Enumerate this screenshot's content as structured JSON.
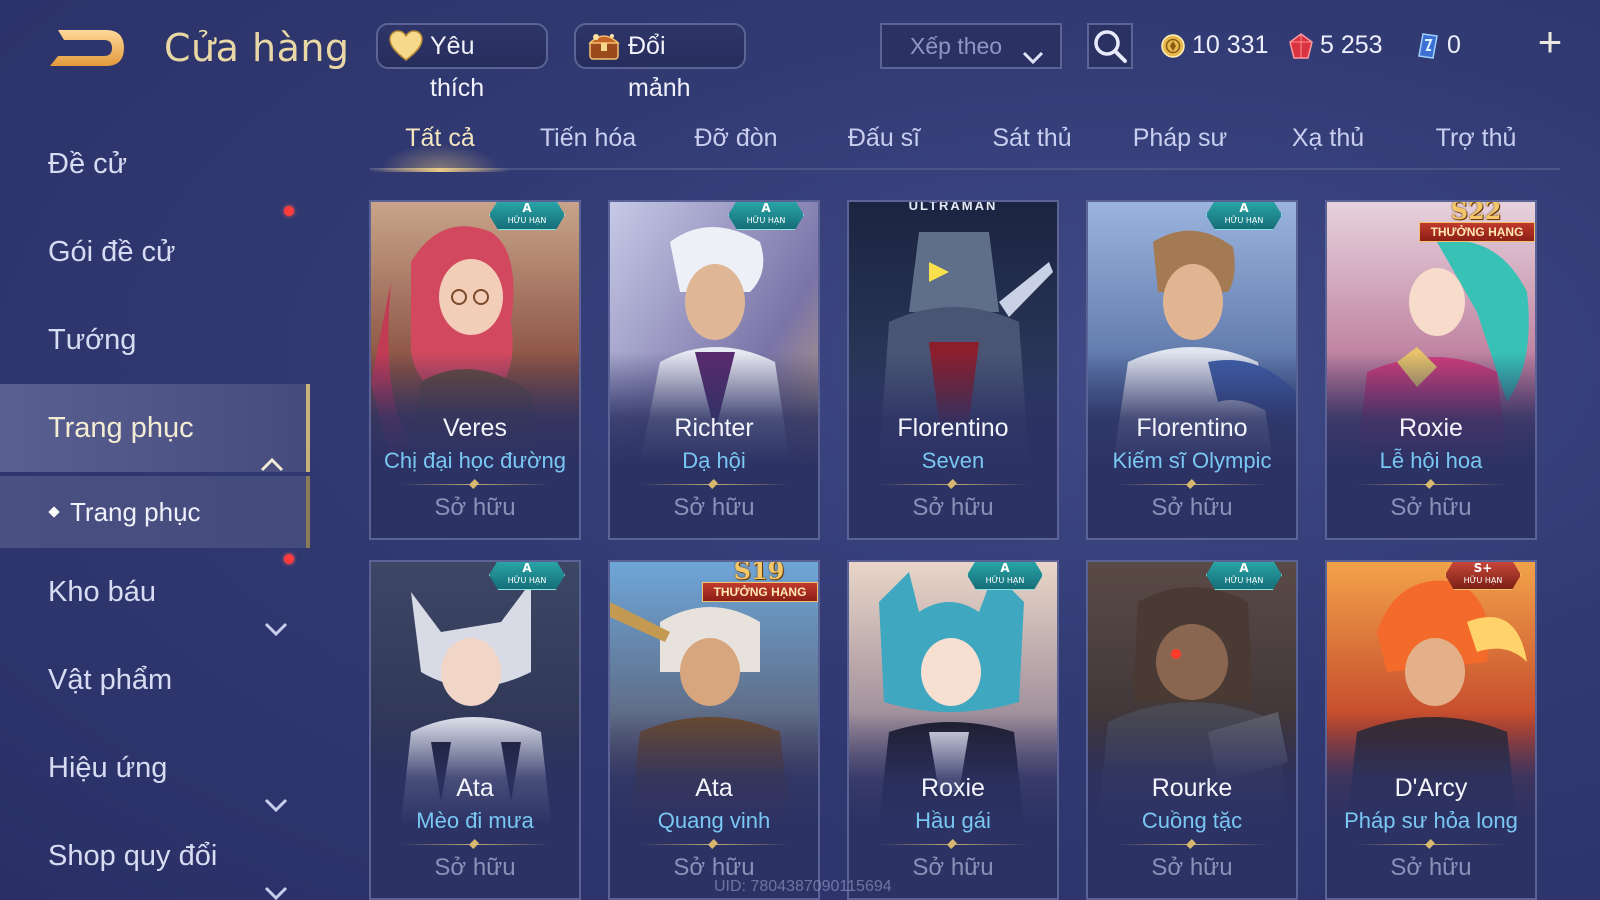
{
  "header": {
    "title": "Cửa hàng",
    "favorite_label": "Yêu thích",
    "shard_label": "Đổi mảnh",
    "sort_label": "Xếp theo",
    "currencies": [
      {
        "icon": "gold-coin-icon",
        "value": "10 331"
      },
      {
        "icon": "ruby-icon",
        "value": "5 253"
      },
      {
        "icon": "crystal-icon",
        "value": "0"
      }
    ],
    "plus_label": "+"
  },
  "sidebar": {
    "items": [
      {
        "label": "Đề cử"
      },
      {
        "label": "Gói đề cử"
      },
      {
        "label": "Tướng"
      },
      {
        "label": "Trang phục"
      },
      {
        "label": "Kho báu"
      },
      {
        "label": "Vật phẩm"
      },
      {
        "label": "Hiệu ứng"
      },
      {
        "label": "Shop quy đổi"
      }
    ],
    "sub_item": {
      "label": "Trang phục"
    }
  },
  "tabs": [
    {
      "label": "Tất cả"
    },
    {
      "label": "Tiến hóa"
    },
    {
      "label": "Đỡ đòn"
    },
    {
      "label": "Đấu sĩ"
    },
    {
      "label": "Sát thủ"
    },
    {
      "label": "Pháp sư"
    },
    {
      "label": "Xạ thủ"
    },
    {
      "label": "Trợ thủ"
    }
  ],
  "cards": [
    {
      "hero": "Veres",
      "skin": "Chị đại học đường",
      "status": "Sở hữu",
      "grade": "A",
      "badge_text": "HỮU HẠN"
    },
    {
      "hero": "Richter",
      "skin": "Dạ hội",
      "status": "Sở hữu",
      "grade": "A",
      "badge_text": "HỮU HẠN"
    },
    {
      "hero": "Florentino",
      "skin": "Seven",
      "status": "Sở hữu",
      "collab": "ULTRAMAN"
    },
    {
      "hero": "Florentino",
      "skin": "Kiếm sĩ Olympic",
      "status": "Sở hữu",
      "grade": "A",
      "badge_text": "HỮU HẠN"
    },
    {
      "hero": "Roxie",
      "skin": "Lễ hội hoa",
      "status": "Sở hữu",
      "season": "S22",
      "rank_text": "THƯỞNG HẠNG"
    },
    {
      "hero": "Ata",
      "skin": "Mèo đi mưa",
      "status": "Sở hữu",
      "grade": "A",
      "badge_text": "HỮU HẠN"
    },
    {
      "hero": "Ata",
      "skin": "Quang vinh",
      "status": "Sở hữu",
      "season": "S19",
      "rank_text": "THƯỞNG HẠNG"
    },
    {
      "hero": "Roxie",
      "skin": "Hầu gái",
      "status": "Sở hữu",
      "grade": "A",
      "badge_text": "HỮU HẠN"
    },
    {
      "hero": "Rourke",
      "skin": "Cuồng tặc",
      "status": "Sở hữu",
      "grade": "A",
      "badge_text": "HỮU HẠN"
    },
    {
      "hero": "D'Arcy",
      "skin": "Pháp sư hỏa long",
      "status": "Sở hữu",
      "grade": "S+",
      "badge_text": "HỮU HẠN"
    }
  ],
  "uid_text": "UID: 7804387090115694",
  "colors": {
    "accent_gold": "#e9c987",
    "skin_blue": "#79c7f2",
    "bg": "#323a73",
    "notify_red": "#ff3b3b"
  }
}
